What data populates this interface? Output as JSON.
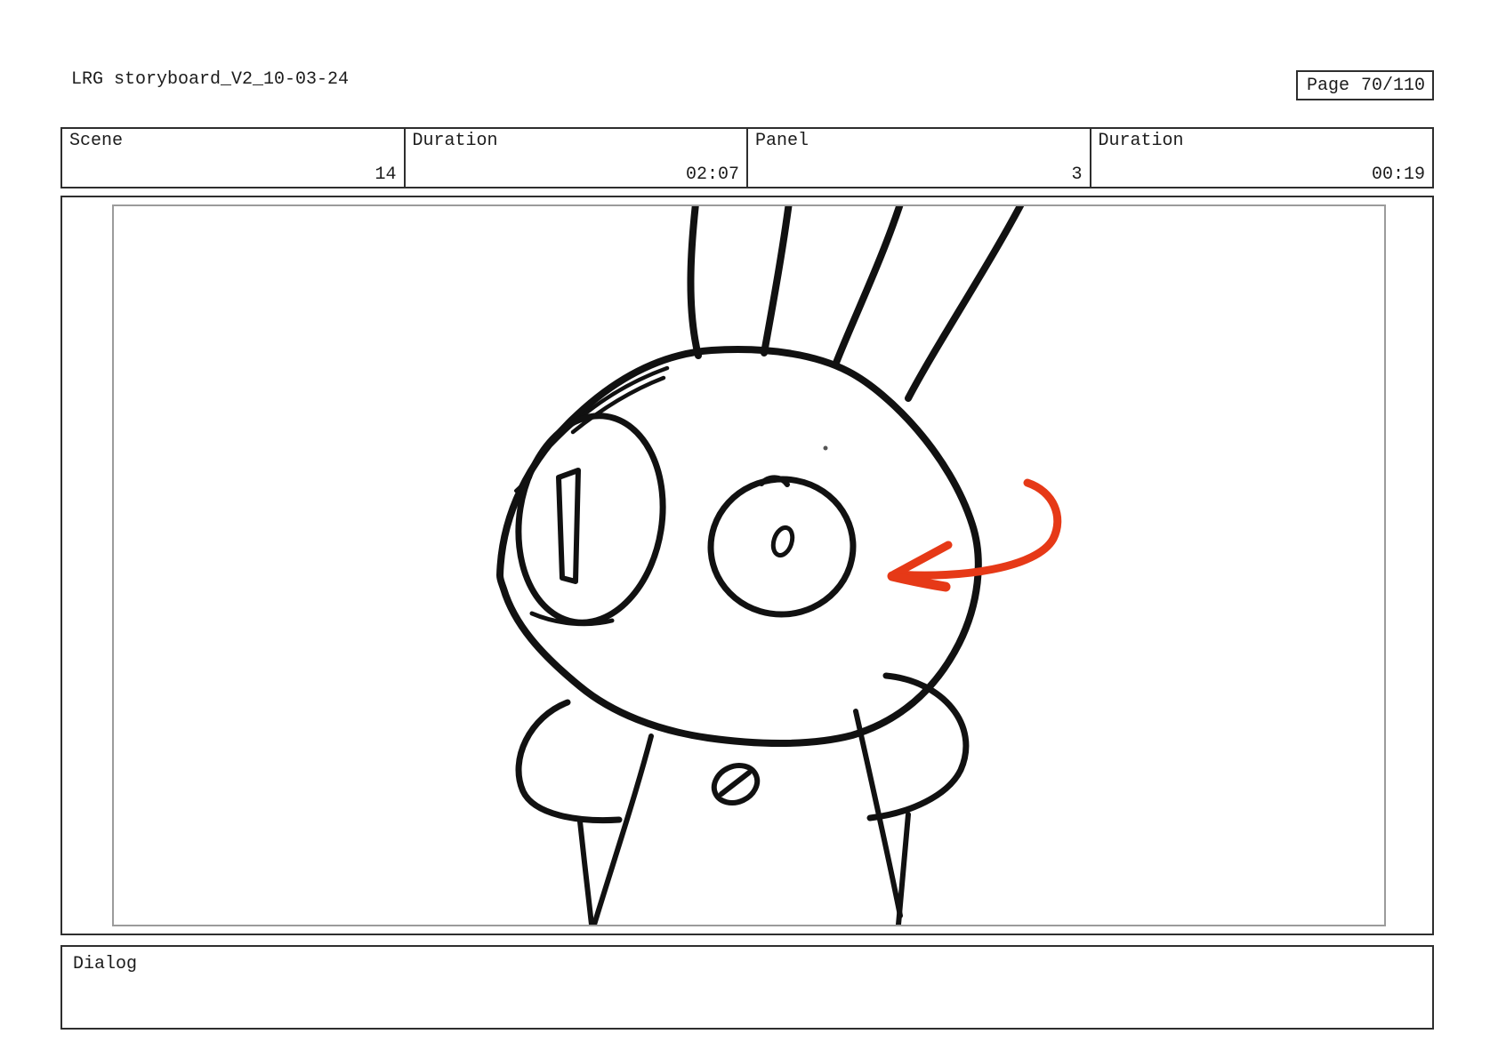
{
  "doc": {
    "title": "LRG storyboard_V2_10-03-24"
  },
  "page_indicator": {
    "label": "Page",
    "value": "70/110"
  },
  "info_table": {
    "cells": [
      {
        "label": "Scene",
        "value": "14"
      },
      {
        "label": "Duration",
        "value": "02:07"
      },
      {
        "label": "Panel",
        "value": "3"
      },
      {
        "label": "Duration",
        "value": "00:19"
      }
    ]
  },
  "dialog": {
    "label": "Dialog"
  },
  "sketch": {
    "subject": "cartoon character head with four quill lines on top, large left eye with window highlight, round right eye with small pupil, shoulders, arms and chest button",
    "annotation": "red curved arrow pointing left toward the head",
    "ink_color": "#111111",
    "annotation_color": "#e63917",
    "frame_border_color": "#9b9b9b"
  }
}
